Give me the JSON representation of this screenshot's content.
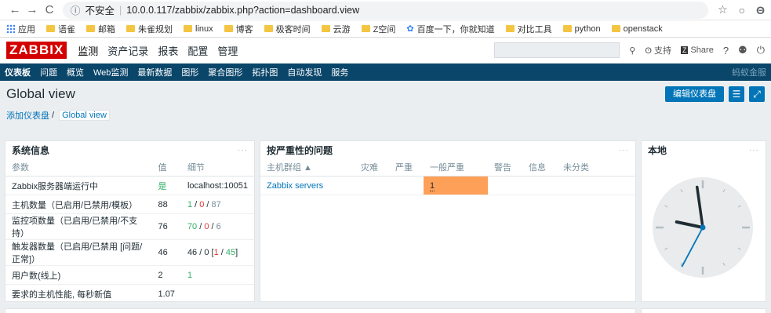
{
  "browser": {
    "nav": {
      "back": "←",
      "forward": "→",
      "reload": "C"
    },
    "security_label": "不安全",
    "url_host": "10.0.0.117",
    "url_path": "/zabbix/zabbix.php?action=dashboard.view",
    "bookmarks": [
      "应用",
      "语雀",
      "邮箱",
      "朱雀规划",
      "linux",
      "博客",
      "极客时间",
      "云游",
      "Z空间",
      "百度一下，你就知道",
      "对比工具",
      "python",
      "openstack"
    ]
  },
  "zabbix": {
    "logo": "ZABBIX",
    "main_menu": [
      "监测",
      "资产记录",
      "报表",
      "配置",
      "管理"
    ],
    "support": "支持",
    "share": "Share",
    "help": "?",
    "sub_menu": [
      "仪表板",
      "问题",
      "概览",
      "Web监测",
      "最新数据",
      "图形",
      "聚合图形",
      "拓扑图",
      "自动发现",
      "服务"
    ],
    "sub_menu_right": "蚂蚁金服"
  },
  "page": {
    "title": "Global view",
    "edit_button": "编辑仪表盘",
    "breadcrumb_parent": "添加仪表盘",
    "breadcrumb_sep": "/",
    "breadcrumb_current": "Global view"
  },
  "widgets": {
    "sysinfo": {
      "title": "系统信息",
      "dots": "···",
      "col_param": "参数",
      "col_value": "值",
      "col_detail": "细节",
      "rows": [
        {
          "param": "Zabbix服务器端运行中",
          "value": "是",
          "detail": "localhost:10051"
        },
        {
          "param": "主机数量（已启用/已禁用/模板）",
          "value": "88",
          "d1": "1",
          "d2": "0",
          "d3": "87"
        },
        {
          "param": "监控项数量（已启用/已禁用/不支持）",
          "value": "76",
          "d1": "70",
          "d2": "0",
          "d3": "6"
        },
        {
          "param": "触发器数量（已启用/已禁用 [问题/正常]）",
          "value": "46",
          "d1": "46",
          "d2": "0",
          "d3": "1",
          "d4": "45"
        },
        {
          "param": "用户数(线上)",
          "value": "2",
          "detail": "1"
        },
        {
          "param": "要求的主机性能, 每秒新值",
          "value": "1.07",
          "detail": ""
        }
      ]
    },
    "problems": {
      "title": "按严重性的问题",
      "dots": "···",
      "columns": [
        "主机群组 ▲",
        "灾难",
        "严重",
        "一般严重",
        "警告",
        "信息",
        "未分类"
      ],
      "rows": [
        {
          "group": "Zabbix servers",
          "disaster": "",
          "high": "",
          "average": "1",
          "warning": "",
          "info": "",
          "nc": ""
        }
      ]
    },
    "clock": {
      "title": "本地",
      "dots": "···",
      "hour_deg": -78,
      "minute_deg": -8,
      "second_deg": 208
    }
  },
  "colors": {
    "navy": "#0a466a",
    "accent": "#0275b8",
    "average": "#ffa059",
    "logo": "#d40000"
  }
}
